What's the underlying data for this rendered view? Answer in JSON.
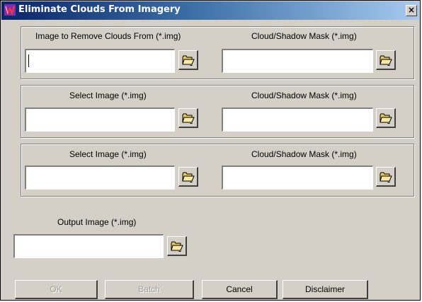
{
  "window": {
    "title": "Eliminate Clouds From Imagery",
    "close_glyph": "×",
    "icon": "app-icon"
  },
  "groups": [
    {
      "image_label": "Image to Remove Clouds From (*.img)",
      "image_value": "",
      "mask_label": "Cloud/Shadow Mask (*.img)",
      "mask_value": ""
    },
    {
      "image_label": "Select Image (*.img)",
      "image_value": "",
      "mask_label": "Cloud/Shadow Mask (*.img)",
      "mask_value": ""
    },
    {
      "image_label": "Select Image (*.img)",
      "image_value": "",
      "mask_label": "Cloud/Shadow Mask (*.img)",
      "mask_value": ""
    }
  ],
  "output": {
    "label": "Output Image (*.img)",
    "value": ""
  },
  "buttons": {
    "ok": "OK",
    "batch": "Batch",
    "cancel": "Cancel",
    "disclaimer": "Disclaimer"
  },
  "icons": {
    "browse": "folder-open-icon"
  }
}
